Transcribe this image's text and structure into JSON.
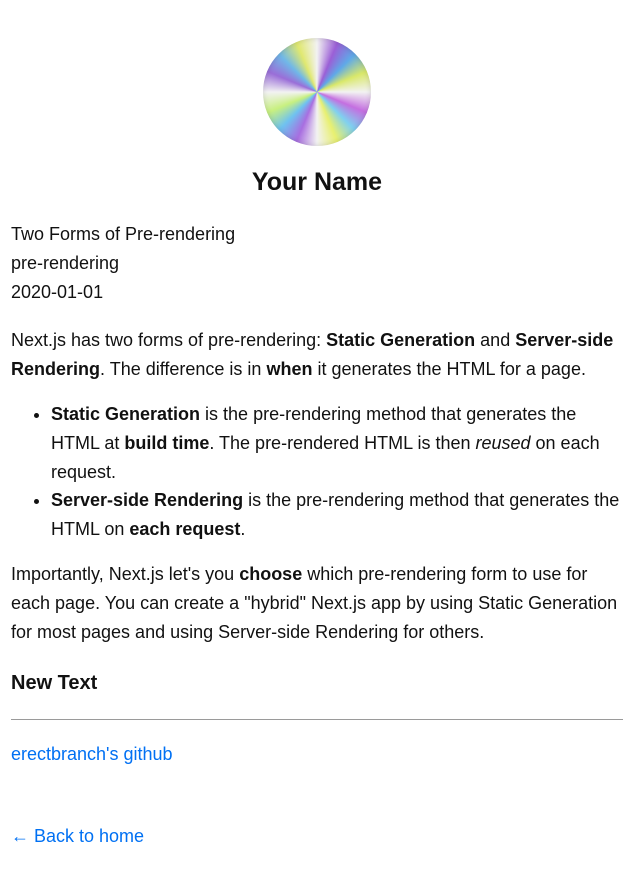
{
  "header": {
    "name": "Your Name"
  },
  "post": {
    "title": "Two Forms of Pre-rendering",
    "id": "pre-rendering",
    "date": "2020-01-01"
  },
  "content": {
    "p1": {
      "a": "Next.js has two forms of pre-rendering: ",
      "b1": "Static Generation",
      "c": " and ",
      "b2": "Server-side Rendering",
      "d": ". The difference is in ",
      "b3": "when",
      "e": " it generates the HTML for a page."
    },
    "li1": {
      "b1": "Static Generation",
      "a": " is the pre-rendering method that generates the HTML at ",
      "b2": "build time",
      "c": ". The pre-rendered HTML is then ",
      "i1": "reused",
      "d": " on each request."
    },
    "li2": {
      "b1": "Server-side Rendering",
      "a": " is the pre-rendering method that generates the HTML on ",
      "b2": "each request",
      "c": "."
    },
    "p2": {
      "a": "Importantly, Next.js let's you ",
      "b1": "choose",
      "c": " which pre-rendering form to use for each page. You can create a \"hybrid\" Next.js app by using Static Generation for most pages and using Server-side Rendering for others."
    },
    "h3": "New Text"
  },
  "links": {
    "github": "erectbranch's github",
    "back": "← Back to home"
  },
  "colors": {
    "link": "#0070f3",
    "text": "#111111",
    "divider": "#9a9a9a"
  }
}
